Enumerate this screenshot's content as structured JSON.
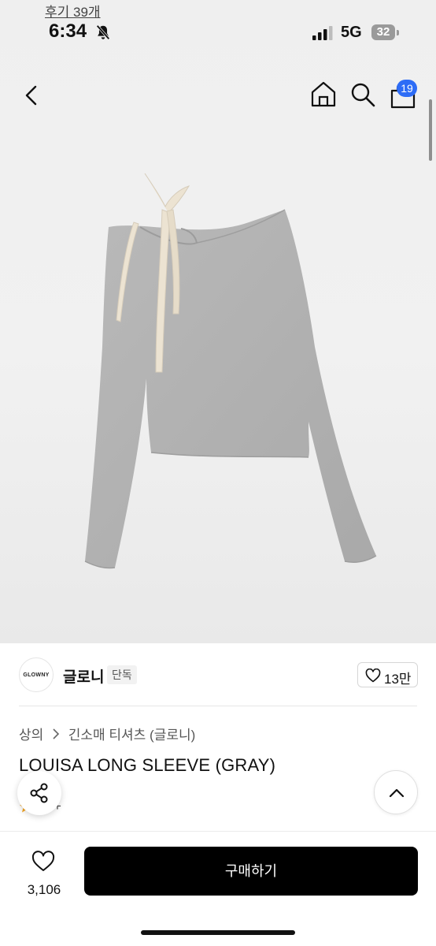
{
  "status_bar": {
    "time": "6:34",
    "network": "5G",
    "battery": "32"
  },
  "nav": {
    "cart_count": "19"
  },
  "icons": {
    "back": "chevron-left-icon",
    "home": "home-icon",
    "search": "search-icon",
    "cart": "shopping-bag-icon",
    "share": "share-icon",
    "scroll_top": "chevron-up-icon",
    "wishlist": "heart-icon"
  },
  "brand": {
    "logo_text": "GLOWNY",
    "name": "글로니",
    "badge": "단독",
    "likes": "13만"
  },
  "breadcrumb": {
    "level1": "상의",
    "level2": "긴소매 티셔츠 (글로니)"
  },
  "product": {
    "title": "LOUISA LONG SLEEVE (GRAY)",
    "rating_prefix": "+",
    "reviews": "후기 39개"
  },
  "bottom_bar": {
    "wish_count": "3,106",
    "buy_label": "구매하기"
  },
  "colors": {
    "accent_blue": "#2d6cf6",
    "buy_button": "#000000",
    "garment_gray": "#b3b3b3",
    "ribbon": "#ece3d2"
  }
}
